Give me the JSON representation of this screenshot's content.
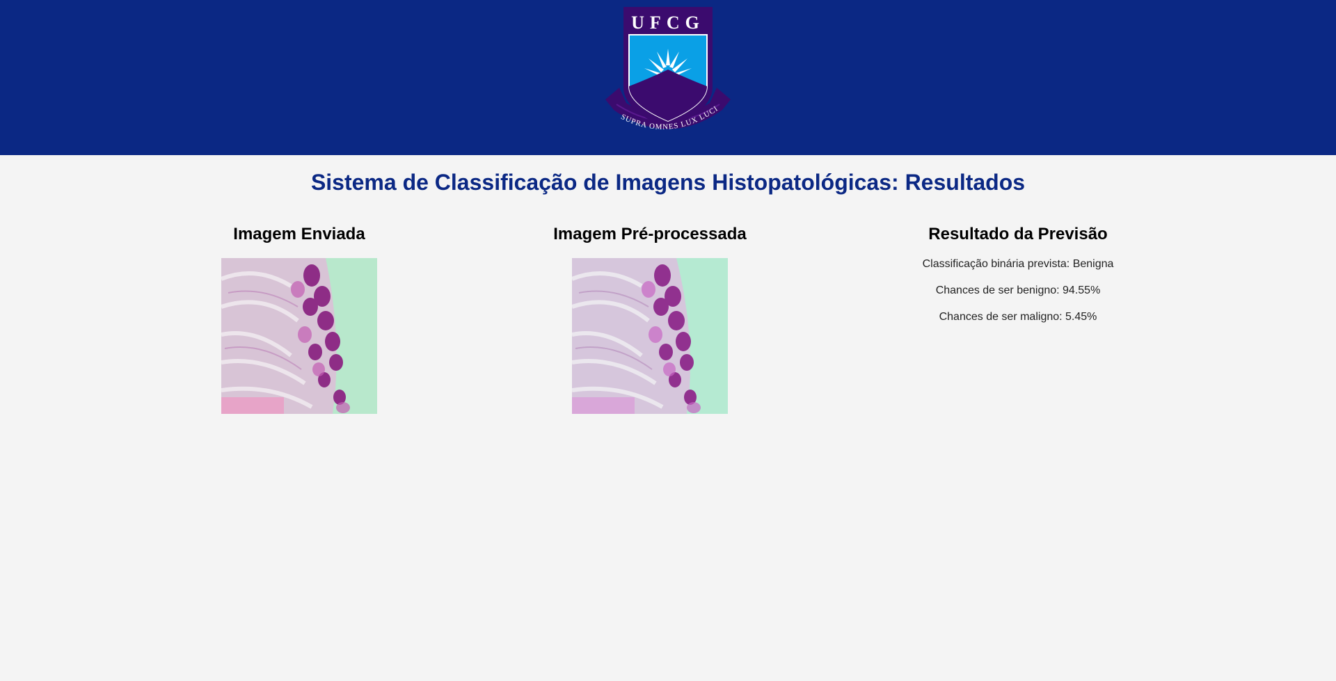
{
  "header": {
    "logo_text": "UFCG",
    "logo_motto": "SUPRA OMNES LUX LUCIS",
    "background_color": "#0b2884"
  },
  "page": {
    "title": "Sistema de Classificação de Imagens Histopatológicas: Resultados"
  },
  "uploaded": {
    "heading": "Imagem Enviada",
    "image_icon": "histopathology-image"
  },
  "preprocessed": {
    "heading": "Imagem Pré-processada",
    "image_icon": "histopathology-image"
  },
  "prediction": {
    "heading": "Resultado da Previsão",
    "binary_label": "Classificação binária prevista: Benigna",
    "benign_chance": "Chances de ser benigno: 94.55%",
    "malignant_chance": "Chances de ser maligno: 5.45%"
  }
}
